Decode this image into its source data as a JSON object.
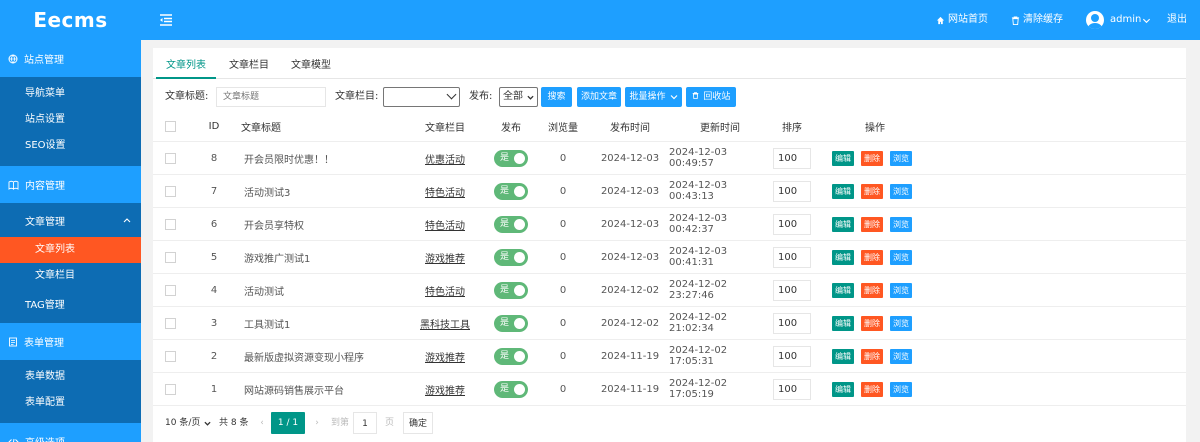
{
  "header": {
    "logo": "Eecms",
    "home_link": "网站首页",
    "clear_cache": "清除缓存",
    "user": "admin",
    "logout": "退出"
  },
  "sidebar": {
    "groups": [
      {
        "label": "站点管理",
        "items": [
          "导航菜单",
          "站点设置",
          "SEO设置"
        ]
      },
      {
        "label": "内容管理",
        "sub_label": "文章管理",
        "sub_items": [
          "文章列表",
          "文章栏目"
        ],
        "items": [
          "TAG管理"
        ]
      },
      {
        "label": "表单管理",
        "items": [
          "表单数据",
          "表单配置"
        ]
      },
      {
        "label": "高级选项"
      }
    ],
    "active_item": "文章列表"
  },
  "tabs": [
    "文章列表",
    "文章栏目",
    "文章模型"
  ],
  "filter": {
    "title_label": "文章标题:",
    "title_placeholder": "文章标题",
    "category_label": "文章栏目:",
    "publish_label": "发布:",
    "publish_value": "全部",
    "search_btn": "搜索",
    "add_btn": "添加文章",
    "batch_btn": "批量操作",
    "recycle_btn": "回收站"
  },
  "table": {
    "headers": [
      "ID",
      "文章标题",
      "文章栏目",
      "发布",
      "浏览量",
      "发布时间",
      "更新时间",
      "排序",
      "操作"
    ],
    "rows": [
      {
        "id": "8",
        "title": "开会员限时优惠！！",
        "category": "优惠活动",
        "publish": "是",
        "views": "0",
        "pub_time": "2024-12-03",
        "upd_time": "2024-12-03 00:49:57",
        "sort": "100"
      },
      {
        "id": "7",
        "title": "活动测试3",
        "category": "特色活动",
        "publish": "是",
        "views": "0",
        "pub_time": "2024-12-03",
        "upd_time": "2024-12-03 00:43:13",
        "sort": "100"
      },
      {
        "id": "6",
        "title": "开会员享特权",
        "category": "特色活动",
        "publish": "是",
        "views": "0",
        "pub_time": "2024-12-03",
        "upd_time": "2024-12-03 00:42:37",
        "sort": "100"
      },
      {
        "id": "5",
        "title": "游戏推广测试1",
        "category": "游戏推荐",
        "publish": "是",
        "views": "0",
        "pub_time": "2024-12-03",
        "upd_time": "2024-12-03 00:41:31",
        "sort": "100"
      },
      {
        "id": "4",
        "title": "活动测试",
        "category": "特色活动",
        "publish": "是",
        "views": "0",
        "pub_time": "2024-12-02",
        "upd_time": "2024-12-02 23:27:46",
        "sort": "100"
      },
      {
        "id": "3",
        "title": "工具测试1",
        "category": "黑科技工具",
        "publish": "是",
        "views": "0",
        "pub_time": "2024-12-02",
        "upd_time": "2024-12-02 21:02:34",
        "sort": "100"
      },
      {
        "id": "2",
        "title": "最新版虚拟资源变现小程序",
        "category": "游戏推荐",
        "publish": "是",
        "views": "0",
        "pub_time": "2024-11-19",
        "upd_time": "2024-12-02 17:05:31",
        "sort": "100"
      },
      {
        "id": "1",
        "title": "网站源码销售展示平台",
        "category": "游戏推荐",
        "publish": "是",
        "views": "0",
        "pub_time": "2024-11-19",
        "upd_time": "2024-12-02 17:05:19",
        "sort": "100"
      }
    ],
    "actions": {
      "edit": "编辑",
      "delete": "删除",
      "view": "浏览"
    }
  },
  "pager": {
    "per_page": "10 条/页",
    "total": "共 8 条",
    "current": "1 / 1",
    "goto_label": "到第",
    "goto_value": "1",
    "page_unit": "页",
    "confirm": "确定"
  },
  "colors": {
    "primary": "#1e9fff",
    "sidebar_bg": "#0d6cb3",
    "active": "#ff5722",
    "teal": "#009688",
    "toggle": "#5fb878"
  }
}
